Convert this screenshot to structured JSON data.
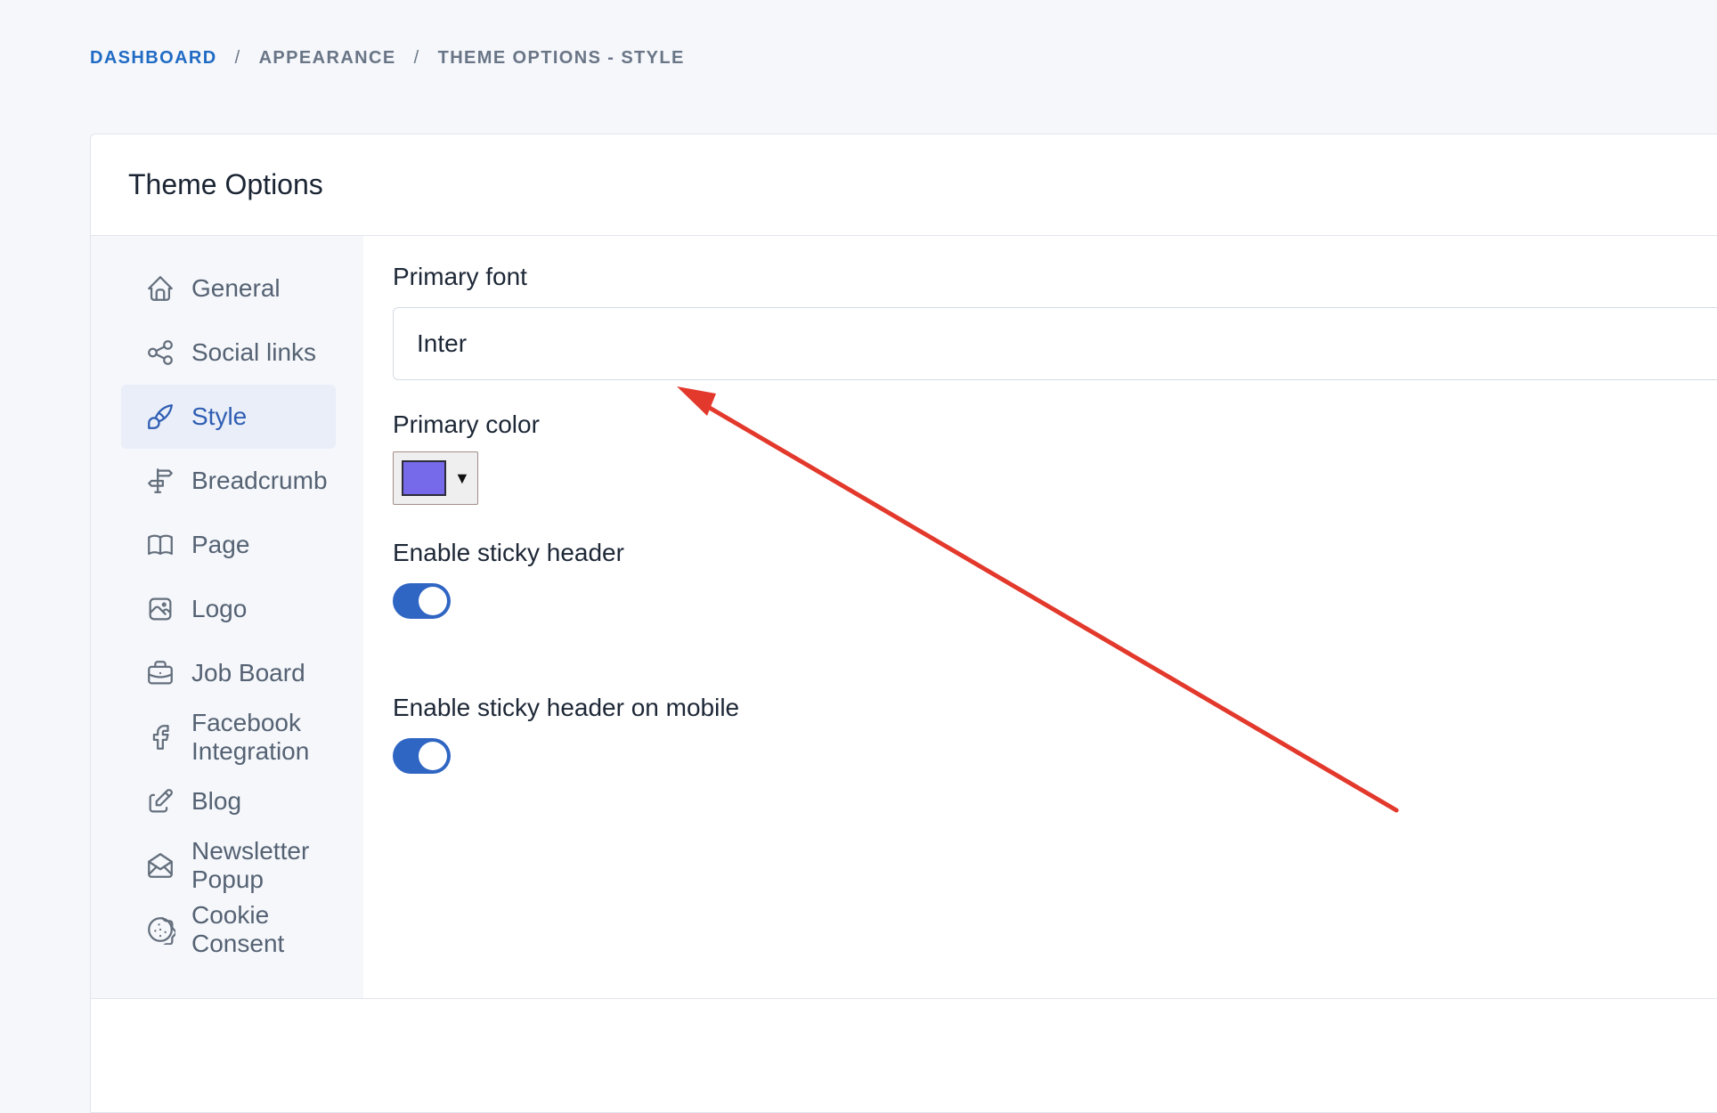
{
  "breadcrumb": {
    "items": [
      "DASHBOARD",
      "APPEARANCE",
      "THEME OPTIONS - STYLE"
    ],
    "separator": "/"
  },
  "card": {
    "title": "Theme Options"
  },
  "sidebar": {
    "items": [
      {
        "label": "General",
        "icon": "home-icon"
      },
      {
        "label": "Social links",
        "icon": "share-icon"
      },
      {
        "label": "Style",
        "icon": "brush-icon",
        "active": true
      },
      {
        "label": "Breadcrumb",
        "icon": "signpost-icon"
      },
      {
        "label": "Page",
        "icon": "book-icon"
      },
      {
        "label": "Logo",
        "icon": "image-icon"
      },
      {
        "label": "Job Board",
        "icon": "briefcase-icon"
      },
      {
        "label": "Facebook Integration",
        "icon": "facebook-icon"
      },
      {
        "label": "Blog",
        "icon": "edit-icon"
      },
      {
        "label": "Newsletter Popup",
        "icon": "mail-opened-icon"
      },
      {
        "label": "Cookie Consent",
        "icon": "cookie-icon"
      }
    ]
  },
  "form": {
    "primary_font": {
      "label": "Primary font",
      "value": "Inter"
    },
    "primary_color": {
      "label": "Primary color",
      "value": "#7669ea",
      "caret": "▼"
    },
    "sticky_header": {
      "label": "Enable sticky header",
      "enabled": true
    },
    "sticky_header_mobile": {
      "label": "Enable sticky header on mobile",
      "enabled": true
    }
  },
  "colors": {
    "accent": "#206bc4",
    "toggle_on": "#2f65c3",
    "annotation_arrow": "#e3392c"
  }
}
